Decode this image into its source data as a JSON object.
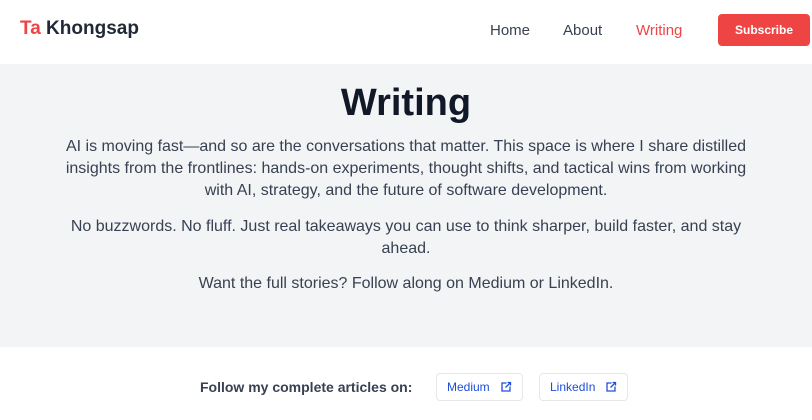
{
  "header": {
    "logo_accent": "Ta",
    "logo_name": "Khongsap",
    "nav": {
      "home": "Home",
      "about": "About",
      "writing": "Writing"
    },
    "subscribe_label": "Subscribe",
    "accent_color": "#ef4444"
  },
  "hero": {
    "title": "Writing",
    "paragraph1": "AI is moving fast—and so are the conversations that matter. This space is where I share distilled insights from the frontlines: hands-on experiments, thought shifts, and tactical wins from working with AI, strategy, and the future of software development.",
    "paragraph2": "No buzzwords. No fluff. Just real takeaways you can use to think sharper, build faster, and stay ahead.",
    "paragraph3": "Want the full stories? Follow along on Medium or LinkedIn."
  },
  "follow": {
    "label": "Follow my complete articles on:",
    "medium_label": "Medium",
    "linkedin_label": "LinkedIn",
    "link_icon": "external-link-icon",
    "link_color": "#1d4ed8"
  }
}
